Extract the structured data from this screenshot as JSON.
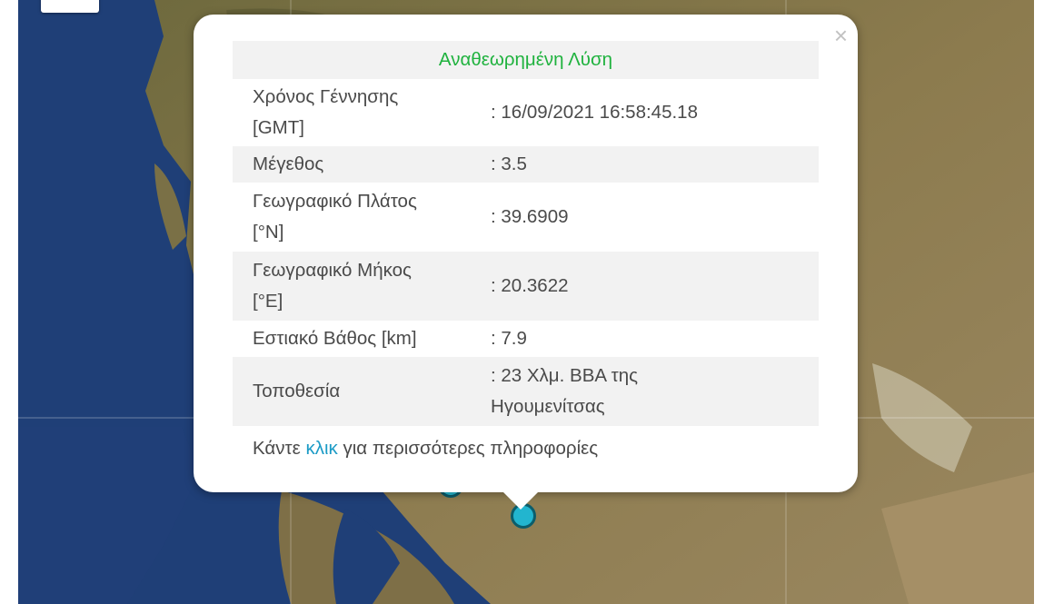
{
  "popup": {
    "title": "Αναθεωρημένη Λύση",
    "close_symbol": "×",
    "rows": [
      {
        "label": "Χρόνος Γέννησης",
        "label2": "[GMT]",
        "value": ": 16/09/2021 16:58:45.18"
      },
      {
        "label": "Μέγεθος",
        "value": ": 3.5"
      },
      {
        "label": "Γεωγραφικό Πλάτος",
        "label2": "[°N]",
        "value": ": 39.6909"
      },
      {
        "label": "Γεωγραφικό Μήκος",
        "label2": "[°E]",
        "value": ": 20.3622"
      },
      {
        "label": "Εστιακό Βάθος [km]",
        "value": ": 7.9"
      },
      {
        "label": "Τοποθεσία",
        "value": ": 23 Χλμ. ΒΒΑ της",
        "value2": "Ηγουμενίτσας"
      }
    ],
    "more_before": "Κάντε ",
    "more_link": "κλικ",
    "more_after": " για περισσότερες πληροφορίες"
  },
  "map": {
    "sea_color": "#1f3f77",
    "land_color": "#8a7a4c",
    "marker_color": "#22b5cf"
  }
}
